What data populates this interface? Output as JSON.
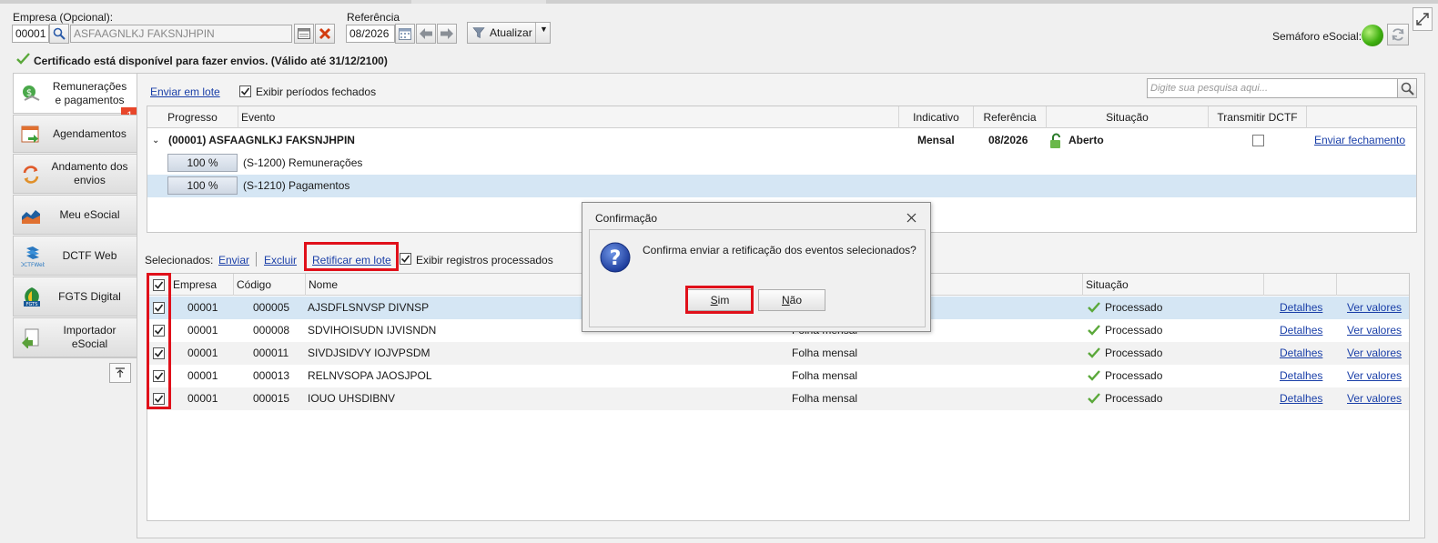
{
  "filters": {
    "empresa_label": "Empresa (Opcional):",
    "empresa_code": "00001",
    "empresa_name": "ASFAAGNLKJ FAKSNJHPIN",
    "referencia_label": "Referência",
    "referencia_value": "08/2026",
    "atualizar_label": "Atualizar"
  },
  "semaforo": {
    "label": "Semáforo eSocial:",
    "status_color": "#3fb010"
  },
  "certificate_text": "Certificado está disponível para fazer envios. (Válido até 31/12/2100)",
  "sidebar": {
    "badge": "1",
    "items": [
      {
        "label": "Remunerações e pagamentos",
        "icon": "money-icon"
      },
      {
        "label": "Agendamentos",
        "icon": "calendar-icon"
      },
      {
        "label": "Andamento dos envios",
        "icon": "cycle-icon"
      },
      {
        "label": "Meu eSocial",
        "icon": "chart-icon"
      },
      {
        "label": "DCTF Web",
        "icon": "dctf-web-icon"
      },
      {
        "label": "FGTS Digital",
        "icon": "fgts-icon"
      },
      {
        "label": "Importador eSocial",
        "icon": "import-icon"
      }
    ]
  },
  "top_panel": {
    "enviar_em_lote": "Enviar em lote",
    "exibir_periodos_fechados": "Exibir períodos fechados",
    "search_placeholder": "Digite sua pesquisa aqui...",
    "columns": [
      "Progresso",
      "Evento",
      "Indicativo",
      "Referência",
      "Situação",
      "Transmitir DCTF"
    ],
    "group": {
      "name": "(00001) ASFAAGNLKJ FAKSNJHPIN",
      "indicativo": "Mensal",
      "referencia": "08/2026",
      "situacao": "Aberto",
      "enviar_fechamento": "Enviar fechamento"
    },
    "events": [
      {
        "progress": "100 %",
        "evento": "(S-1200) Remunerações"
      },
      {
        "progress": "100 %",
        "evento": "(S-1210) Pagamentos"
      }
    ]
  },
  "selection_bar": {
    "label": "Selecionados:",
    "enviar": "Enviar",
    "excluir": "Excluir",
    "retificar": "Retificar em lote",
    "exibir_registros": "Exibir registros processados"
  },
  "bottom_table": {
    "columns": [
      "Empresa",
      "Código",
      "Nome",
      "Situação"
    ],
    "rows": [
      {
        "empresa": "00001",
        "codigo": "000005",
        "nome": "AJSDFLSNVSP DIVNSP",
        "tipo": "",
        "situacao": "Processado",
        "detalhes": "Detalhes",
        "ver_valores": "Ver valores"
      },
      {
        "empresa": "00001",
        "codigo": "000008",
        "nome": "SDVIHOISUDN IJVISNDN",
        "tipo": "Folha mensal",
        "situacao": "Processado",
        "detalhes": "Detalhes",
        "ver_valores": "Ver valores"
      },
      {
        "empresa": "00001",
        "codigo": "000011",
        "nome": "SIVDJSIDVY IOJVPSDM",
        "tipo": "Folha mensal",
        "situacao": "Processado",
        "detalhes": "Detalhes",
        "ver_valores": "Ver valores"
      },
      {
        "empresa": "00001",
        "codigo": "000013",
        "nome": "RELNVSOPA JAOSJPOL",
        "tipo": "Folha mensal",
        "situacao": "Processado",
        "detalhes": "Detalhes",
        "ver_valores": "Ver valores"
      },
      {
        "empresa": "00001",
        "codigo": "000015",
        "nome": "IOUO UHSDIBNV",
        "tipo": "Folha mensal",
        "situacao": "Processado",
        "detalhes": "Detalhes",
        "ver_valores": "Ver valores"
      }
    ]
  },
  "dialog": {
    "title": "Confirmação",
    "message": "Confirma enviar a retificação dos eventos selecionados?",
    "sim_underlined": "S",
    "sim_rest": "im",
    "nao_underlined": "N",
    "nao_rest": "ão"
  },
  "colors": {
    "accent": "#1a3fa8",
    "highlight": "#e20a16",
    "selected_row": "#d5e6f4",
    "ok_green": "#3fa02a"
  }
}
